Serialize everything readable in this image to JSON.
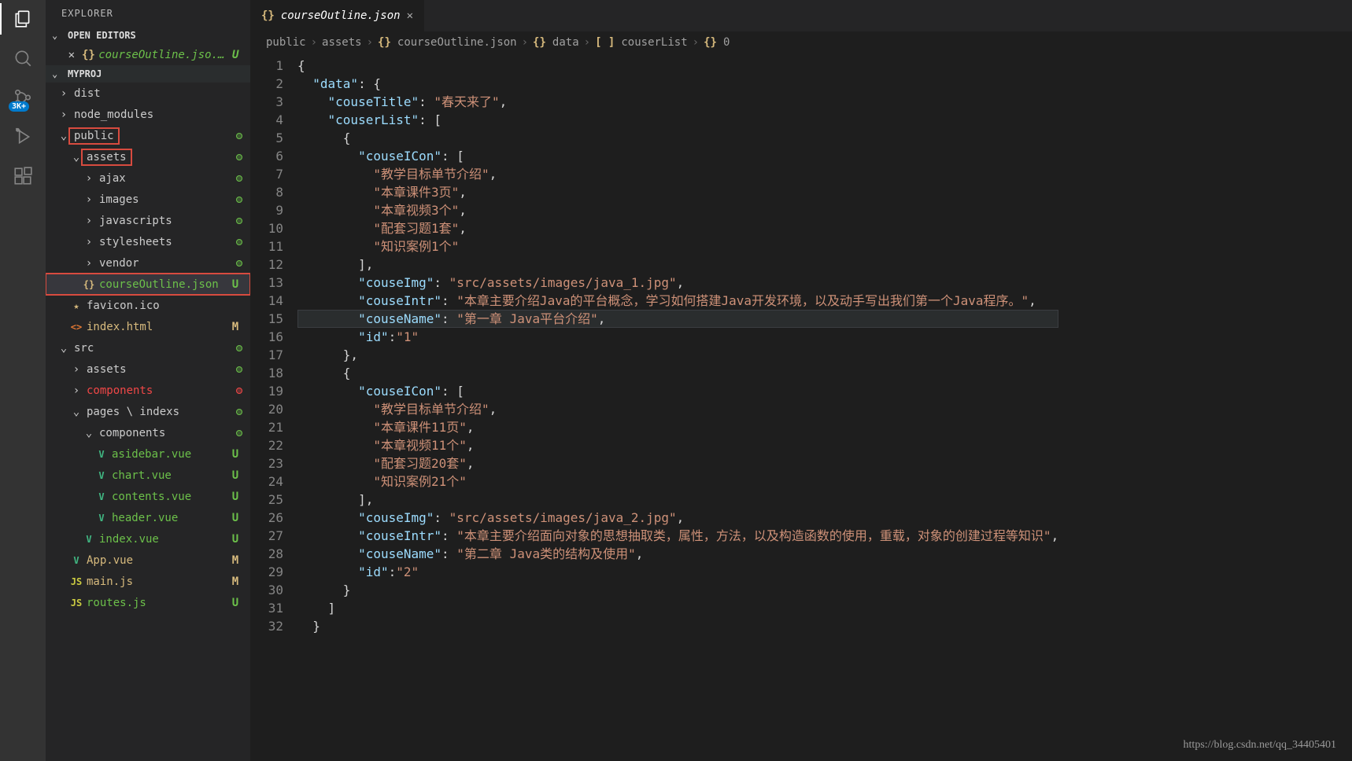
{
  "sidebar": {
    "title": "EXPLORER",
    "openEditors": "OPEN EDITORS",
    "project": "MYPROJ",
    "badge": "3K+",
    "openTab": "courseOutline.jso...",
    "tree": [
      {
        "i": 0,
        "ch": "›",
        "lbl": "dist",
        "cls": ""
      },
      {
        "i": 0,
        "ch": "›",
        "lbl": "node_modules",
        "cls": ""
      },
      {
        "i": 0,
        "ch": "⌄",
        "lbl": "public",
        "cls": "",
        "dot": "green",
        "box": "public"
      },
      {
        "i": 1,
        "ch": "⌄",
        "lbl": "assets",
        "cls": "",
        "dot": "green",
        "box": "assets"
      },
      {
        "i": 2,
        "ch": "›",
        "lbl": "ajax",
        "cls": "",
        "dot": "green"
      },
      {
        "i": 2,
        "ch": "›",
        "lbl": "images",
        "cls": "",
        "dot": "green"
      },
      {
        "i": 2,
        "ch": "›",
        "lbl": "javascripts",
        "cls": "",
        "dot": "green"
      },
      {
        "i": 2,
        "ch": "›",
        "lbl": "stylesheets",
        "cls": "",
        "dot": "green"
      },
      {
        "i": 2,
        "ch": "›",
        "lbl": "vendor",
        "cls": "",
        "dot": "green"
      },
      {
        "i": 2,
        "ico": "{}",
        "icoc": "#d7ba7d",
        "lbl": "courseOutline.json",
        "cls": "fg-green",
        "stat": "U",
        "box": "file",
        "sel": true
      },
      {
        "i": 1,
        "ico": "★",
        "icoc": "#d7ba7d",
        "lbl": "favicon.ico",
        "cls": ""
      },
      {
        "i": 1,
        "ico": "<>",
        "icoc": "#e37933",
        "lbl": "index.html",
        "cls": "fg-yellow",
        "stat": "M"
      },
      {
        "i": 0,
        "ch": "⌄",
        "lbl": "src",
        "cls": "",
        "dot": "green"
      },
      {
        "i": 1,
        "ch": "›",
        "lbl": "assets",
        "cls": "",
        "dot": "green"
      },
      {
        "i": 1,
        "ch": "›",
        "lbl": "components",
        "cls": "fg-red",
        "dot": "red"
      },
      {
        "i": 1,
        "ch": "⌄",
        "lbl": "pages \\ indexs",
        "cls": "",
        "dot": "green"
      },
      {
        "i": 2,
        "ch": "⌄",
        "lbl": "components",
        "cls": "",
        "dot": "green"
      },
      {
        "i": 3,
        "ico": "V",
        "icoc": "#41b883",
        "lbl": "asidebar.vue",
        "cls": "fg-green",
        "stat": "U"
      },
      {
        "i": 3,
        "ico": "V",
        "icoc": "#41b883",
        "lbl": "chart.vue",
        "cls": "fg-green",
        "stat": "U"
      },
      {
        "i": 3,
        "ico": "V",
        "icoc": "#41b883",
        "lbl": "contents.vue",
        "cls": "fg-green",
        "stat": "U"
      },
      {
        "i": 3,
        "ico": "V",
        "icoc": "#41b883",
        "lbl": "header.vue",
        "cls": "fg-green",
        "stat": "U"
      },
      {
        "i": 2,
        "ico": "V",
        "icoc": "#41b883",
        "lbl": "index.vue",
        "cls": "fg-green",
        "stat": "U"
      },
      {
        "i": 1,
        "ico": "V",
        "icoc": "#41b883",
        "lbl": "App.vue",
        "cls": "fg-yellow",
        "stat": "M"
      },
      {
        "i": 1,
        "ico": "JS",
        "icoc": "#cbcb41",
        "lbl": "main.js",
        "cls": "fg-yellow",
        "stat": "M"
      },
      {
        "i": 1,
        "ico": "JS",
        "icoc": "#cbcb41",
        "lbl": "routes.js",
        "cls": "fg-green",
        "stat": "U"
      }
    ]
  },
  "tab": {
    "icon": "{}",
    "label": "courseOutline.json"
  },
  "breadcrumbs": [
    {
      "t": "public"
    },
    {
      "t": "assets"
    },
    {
      "t": "courseOutline.json",
      "ic": "{}"
    },
    {
      "t": "data",
      "ic": "{}"
    },
    {
      "t": "couserList",
      "ic": "[ ]"
    },
    {
      "t": "0",
      "ic": "{}"
    }
  ],
  "code": {
    "start": 1,
    "highlight": 15,
    "tokens": [
      [
        [
          "p",
          "{"
        ]
      ],
      [
        [
          "p",
          "  "
        ],
        [
          "k",
          "\"data\""
        ],
        [
          "p",
          ": {"
        ]
      ],
      [
        [
          "p",
          "    "
        ],
        [
          "k",
          "\"couseTitle\""
        ],
        [
          "p",
          ": "
        ],
        [
          "s",
          "\"春天来了\""
        ],
        [
          "p",
          ","
        ]
      ],
      [
        [
          "p",
          "    "
        ],
        [
          "k",
          "\"couserList\""
        ],
        [
          "p",
          ": ["
        ]
      ],
      [
        [
          "p",
          "      {"
        ]
      ],
      [
        [
          "p",
          "        "
        ],
        [
          "k",
          "\"couseICon\""
        ],
        [
          "p",
          ": ["
        ]
      ],
      [
        [
          "p",
          "          "
        ],
        [
          "s",
          "\"教学目标单节介绍\""
        ],
        [
          "p",
          ","
        ]
      ],
      [
        [
          "p",
          "          "
        ],
        [
          "s",
          "\"本章课件3页\""
        ],
        [
          "p",
          ","
        ]
      ],
      [
        [
          "p",
          "          "
        ],
        [
          "s",
          "\"本章视频3个\""
        ],
        [
          "p",
          ","
        ]
      ],
      [
        [
          "p",
          "          "
        ],
        [
          "s",
          "\"配套习题1套\""
        ],
        [
          "p",
          ","
        ]
      ],
      [
        [
          "p",
          "          "
        ],
        [
          "s",
          "\"知识案例1个\""
        ]
      ],
      [
        [
          "p",
          "        ],"
        ]
      ],
      [
        [
          "p",
          "        "
        ],
        [
          "k",
          "\"couseImg\""
        ],
        [
          "p",
          ": "
        ],
        [
          "s",
          "\"src/assets/images/java_1.jpg\""
        ],
        [
          "p",
          ","
        ]
      ],
      [
        [
          "p",
          "        "
        ],
        [
          "k",
          "\"couseIntr\""
        ],
        [
          "p",
          ": "
        ],
        [
          "s",
          "\"本章主要介绍Java的平台概念，学习如何搭建Java开发环境，以及动手写出我们第一个Java程序。\""
        ],
        [
          "p",
          ","
        ]
      ],
      [
        [
          "p",
          "        "
        ],
        [
          "k",
          "\"couseName\""
        ],
        [
          "p",
          ": "
        ],
        [
          "s",
          "\"第一章 Java平台介绍\""
        ],
        [
          "p",
          ","
        ]
      ],
      [
        [
          "p",
          "        "
        ],
        [
          "k",
          "\"id\""
        ],
        [
          "p",
          ":"
        ],
        [
          "s",
          "\"1\""
        ]
      ],
      [
        [
          "p",
          "      },"
        ]
      ],
      [
        [
          "p",
          "      {"
        ]
      ],
      [
        [
          "p",
          "        "
        ],
        [
          "k",
          "\"couseICon\""
        ],
        [
          "p",
          ": ["
        ]
      ],
      [
        [
          "p",
          "          "
        ],
        [
          "s",
          "\"教学目标单节介绍\""
        ],
        [
          "p",
          ","
        ]
      ],
      [
        [
          "p",
          "          "
        ],
        [
          "s",
          "\"本章课件11页\""
        ],
        [
          "p",
          ","
        ]
      ],
      [
        [
          "p",
          "          "
        ],
        [
          "s",
          "\"本章视频11个\""
        ],
        [
          "p",
          ","
        ]
      ],
      [
        [
          "p",
          "          "
        ],
        [
          "s",
          "\"配套习题20套\""
        ],
        [
          "p",
          ","
        ]
      ],
      [
        [
          "p",
          "          "
        ],
        [
          "s",
          "\"知识案例21个\""
        ]
      ],
      [
        [
          "p",
          "        ],"
        ]
      ],
      [
        [
          "p",
          "        "
        ],
        [
          "k",
          "\"couseImg\""
        ],
        [
          "p",
          ": "
        ],
        [
          "s",
          "\"src/assets/images/java_2.jpg\""
        ],
        [
          "p",
          ","
        ]
      ],
      [
        [
          "p",
          "        "
        ],
        [
          "k",
          "\"couseIntr\""
        ],
        [
          "p",
          ": "
        ],
        [
          "s",
          "\"本章主要介绍面向对象的思想抽取类，属性，方法，以及构造函数的使用，重载，对象的创建过程等知识\""
        ],
        [
          "p",
          ","
        ]
      ],
      [
        [
          "p",
          "        "
        ],
        [
          "k",
          "\"couseName\""
        ],
        [
          "p",
          ": "
        ],
        [
          "s",
          "\"第二章 Java类的结构及使用\""
        ],
        [
          "p",
          ","
        ]
      ],
      [
        [
          "p",
          "        "
        ],
        [
          "k",
          "\"id\""
        ],
        [
          "p",
          ":"
        ],
        [
          "s",
          "\"2\""
        ]
      ],
      [
        [
          "p",
          "      }"
        ]
      ],
      [
        [
          "p",
          "    ]"
        ]
      ],
      [
        [
          "p",
          "  }"
        ]
      ]
    ]
  },
  "watermark": "https://blog.csdn.net/qq_34405401"
}
